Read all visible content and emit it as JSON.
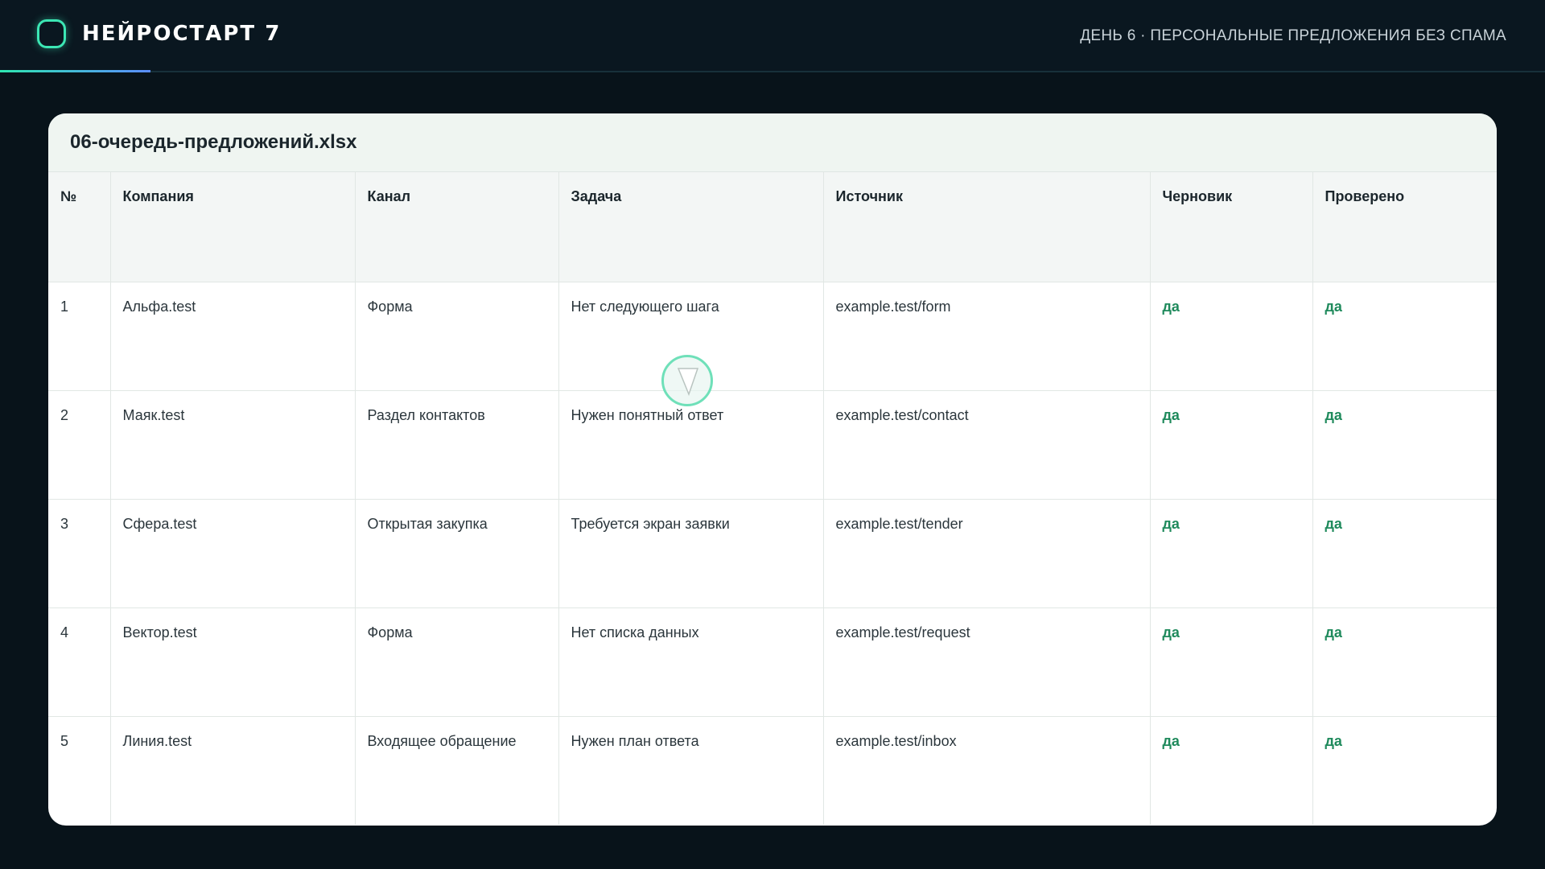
{
  "header": {
    "brand": "НЕЙРОСТАРТ 7",
    "day_label": "ДЕНЬ 6 · ПЕРСОНАЛЬНЫЕ ПРЕДЛОЖЕНИЯ БЕЗ СПАМА",
    "accent_color": "#3ce6b4"
  },
  "sheet": {
    "filename": "06-очередь-предложений.xlsx",
    "columns": [
      "№",
      "Компания",
      "Канал",
      "Задача",
      "Источник",
      "Черновик",
      "Проверено"
    ],
    "rows": [
      [
        "1",
        "Альфа.test",
        "Форма",
        "Нет следующего шага",
        "example.test/form",
        "да",
        "да"
      ],
      [
        "2",
        "Маяк.test",
        "Раздел контактов",
        "Нужен понятный ответ",
        "example.test/contact",
        "да",
        "да"
      ],
      [
        "3",
        "Сфера.test",
        "Открытая закупка",
        "Требуется экран заявки",
        "example.test/tender",
        "да",
        "да"
      ],
      [
        "4",
        "Вектор.test",
        "Форма",
        "Нет списка данных",
        "example.test/request",
        "да",
        "да"
      ],
      [
        "5",
        "Линия.test",
        "Входящее обращение",
        "Нужен план ответа",
        "example.test/inbox",
        "да",
        "да"
      ]
    ],
    "ok_color": "#1f8a5c"
  },
  "cursor": {
    "icon": "pointer-cursor-icon"
  }
}
